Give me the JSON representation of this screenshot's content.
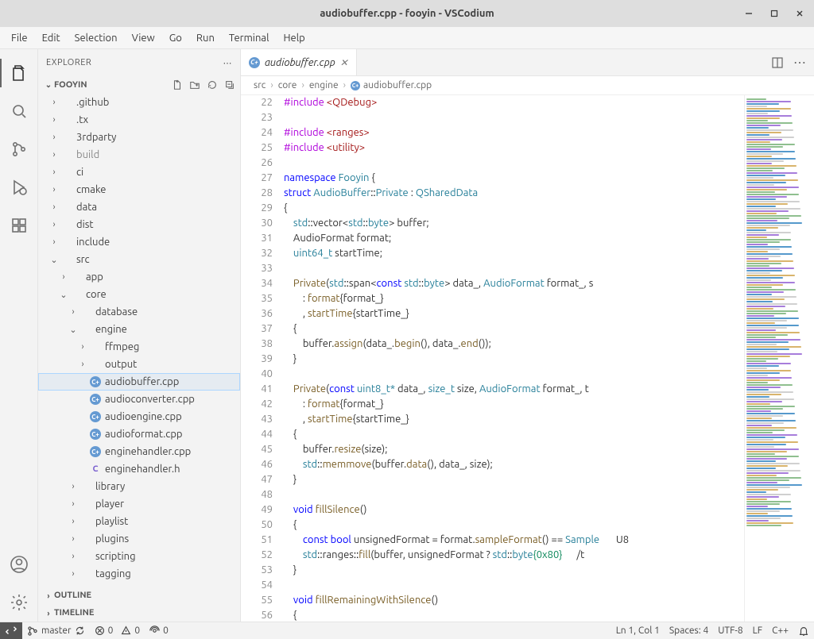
{
  "title": "audiobuffer.cpp - fooyin - VSCodium",
  "menus": [
    "File",
    "Edit",
    "Selection",
    "View",
    "Go",
    "Run",
    "Terminal",
    "Help"
  ],
  "explorer": {
    "title": "EXPLORER",
    "project": "FOOYIN",
    "outline": "OUTLINE",
    "timeline": "TIMELINE"
  },
  "tree": [
    {
      "d": 0,
      "t": "folder",
      "e": false,
      "l": ".github"
    },
    {
      "d": 0,
      "t": "folder",
      "e": false,
      "l": ".tx"
    },
    {
      "d": 0,
      "t": "folder",
      "e": false,
      "l": "3rdparty"
    },
    {
      "d": 0,
      "t": "folder",
      "e": false,
      "l": "build",
      "dim": true
    },
    {
      "d": 0,
      "t": "folder",
      "e": false,
      "l": "ci"
    },
    {
      "d": 0,
      "t": "folder",
      "e": false,
      "l": "cmake"
    },
    {
      "d": 0,
      "t": "folder",
      "e": false,
      "l": "data"
    },
    {
      "d": 0,
      "t": "folder",
      "e": false,
      "l": "dist"
    },
    {
      "d": 0,
      "t": "folder",
      "e": false,
      "l": "include"
    },
    {
      "d": 0,
      "t": "folder",
      "e": true,
      "l": "src"
    },
    {
      "d": 1,
      "t": "folder",
      "e": false,
      "l": "app"
    },
    {
      "d": 1,
      "t": "folder",
      "e": true,
      "l": "core"
    },
    {
      "d": 2,
      "t": "folder",
      "e": false,
      "l": "database"
    },
    {
      "d": 2,
      "t": "folder",
      "e": true,
      "l": "engine"
    },
    {
      "d": 3,
      "t": "folder",
      "e": false,
      "l": "ffmpeg"
    },
    {
      "d": 3,
      "t": "folder",
      "e": false,
      "l": "output"
    },
    {
      "d": 3,
      "t": "cpp",
      "l": "audiobuffer.cpp",
      "sel": true
    },
    {
      "d": 3,
      "t": "cpp",
      "l": "audioconverter.cpp"
    },
    {
      "d": 3,
      "t": "cpp",
      "l": "audioengine.cpp"
    },
    {
      "d": 3,
      "t": "cpp",
      "l": "audioformat.cpp"
    },
    {
      "d": 3,
      "t": "cpp",
      "l": "enginehandler.cpp"
    },
    {
      "d": 3,
      "t": "h",
      "l": "enginehandler.h"
    },
    {
      "d": 2,
      "t": "folder",
      "e": false,
      "l": "library"
    },
    {
      "d": 2,
      "t": "folder",
      "e": false,
      "l": "player"
    },
    {
      "d": 2,
      "t": "folder",
      "e": false,
      "l": "playlist"
    },
    {
      "d": 2,
      "t": "folder",
      "e": false,
      "l": "plugins"
    },
    {
      "d": 2,
      "t": "folder",
      "e": false,
      "l": "scripting"
    },
    {
      "d": 2,
      "t": "folder",
      "e": false,
      "l": "tagging"
    }
  ],
  "tab": {
    "label": "audiobuffer.cpp"
  },
  "crumbs": [
    "src",
    "core",
    "engine",
    "audiobuffer.cpp"
  ],
  "code_start": 22,
  "code": [
    [
      [
        "pp",
        "#include"
      ],
      [
        "",
        ""
      ],
      [
        "st",
        " <QDebug>"
      ]
    ],
    [],
    [
      [
        "pp",
        "#include"
      ],
      [
        "st",
        " <ranges>"
      ]
    ],
    [
      [
        "pp",
        "#include"
      ],
      [
        "st",
        " <utility>"
      ]
    ],
    [],
    [
      [
        "kw",
        "namespace"
      ],
      [
        "",
        " "
      ],
      [
        "ty",
        "Fooyin"
      ],
      [
        "",
        " {"
      ]
    ],
    [
      [
        "kw",
        "struct"
      ],
      [
        "",
        " "
      ],
      [
        "ty",
        "AudioBuffer"
      ],
      [
        "op",
        "::"
      ],
      [
        "ty",
        "Private"
      ],
      [
        "",
        " : "
      ],
      [
        "ty",
        "QSharedData"
      ]
    ],
    [
      [
        "",
        "{"
      ]
    ],
    [
      [
        "",
        "    "
      ],
      [
        "ty",
        "std"
      ],
      [
        "op",
        "::"
      ],
      [
        "",
        "vector<"
      ],
      [
        "ty",
        "std"
      ],
      [
        "op",
        "::"
      ],
      [
        "ty",
        "byte"
      ],
      [
        "",
        "> buffer;"
      ]
    ],
    [
      [
        "",
        "    AudioFormat format;"
      ]
    ],
    [
      [
        "",
        "    "
      ],
      [
        "ty",
        "uint64_t"
      ],
      [
        "",
        " startTime;"
      ]
    ],
    [],
    [
      [
        "",
        "    "
      ],
      [
        "fn",
        "Private"
      ],
      [
        "",
        "("
      ],
      [
        "ty",
        "std"
      ],
      [
        "op",
        "::"
      ],
      [
        "",
        "span<"
      ],
      [
        "kw",
        "const"
      ],
      [
        "",
        " "
      ],
      [
        "ty",
        "std"
      ],
      [
        "op",
        "::"
      ],
      [
        "ty",
        "byte"
      ],
      [
        "",
        "> data_, "
      ],
      [
        "ty",
        "AudioFormat"
      ],
      [
        "",
        " format_, s"
      ]
    ],
    [
      [
        "",
        "        : "
      ],
      [
        "fn",
        "format"
      ],
      [
        "",
        "{format_}"
      ]
    ],
    [
      [
        "",
        "        , "
      ],
      [
        "fn",
        "startTime"
      ],
      [
        "",
        "{startTime_}"
      ]
    ],
    [
      [
        "",
        "    {"
      ]
    ],
    [
      [
        "",
        "        buffer."
      ],
      [
        "fn",
        "assign"
      ],
      [
        "",
        "(data_."
      ],
      [
        "fn",
        "begin"
      ],
      [
        "",
        "(), data_."
      ],
      [
        "fn",
        "end"
      ],
      [
        "",
        "());"
      ]
    ],
    [
      [
        "",
        "    }"
      ]
    ],
    [],
    [
      [
        "",
        "    "
      ],
      [
        "fn",
        "Private"
      ],
      [
        "",
        "("
      ],
      [
        "kw",
        "const"
      ],
      [
        "",
        " "
      ],
      [
        "ty",
        "uint8_t*"
      ],
      [
        "",
        " data_, "
      ],
      [
        "ty",
        "size_t"
      ],
      [
        "",
        " size, "
      ],
      [
        "ty",
        "AudioFormat"
      ],
      [
        "",
        " format_, t"
      ]
    ],
    [
      [
        "",
        "        : "
      ],
      [
        "fn",
        "format"
      ],
      [
        "",
        "{format_}"
      ]
    ],
    [
      [
        "",
        "        , "
      ],
      [
        "fn",
        "startTime"
      ],
      [
        "",
        "{startTime_}"
      ]
    ],
    [
      [
        "",
        "    {"
      ]
    ],
    [
      [
        "",
        "        buffer."
      ],
      [
        "fn",
        "resize"
      ],
      [
        "",
        "(size);"
      ]
    ],
    [
      [
        "",
        "        "
      ],
      [
        "ty",
        "std"
      ],
      [
        "op",
        "::"
      ],
      [
        "fn",
        "memmove"
      ],
      [
        "",
        "(buffer."
      ],
      [
        "fn",
        "data"
      ],
      [
        "",
        "(), data_, size);"
      ]
    ],
    [
      [
        "",
        "    }"
      ]
    ],
    [],
    [
      [
        "",
        "    "
      ],
      [
        "kw",
        "void"
      ],
      [
        "",
        " "
      ],
      [
        "fn",
        "fillSilence"
      ],
      [
        "",
        "()"
      ]
    ],
    [
      [
        "",
        "    {"
      ]
    ],
    [
      [
        "",
        "        "
      ],
      [
        "kw",
        "const"
      ],
      [
        "",
        " "
      ],
      [
        "kw",
        "bool"
      ],
      [
        "",
        " unsignedFormat = format."
      ],
      [
        "fn",
        "sampleFormat"
      ],
      [
        "",
        "() == "
      ],
      [
        "ty",
        "Sample"
      ],
      [
        "",
        "       U8"
      ]
    ],
    [
      [
        "",
        "        "
      ],
      [
        "ty",
        "std"
      ],
      [
        "op",
        "::"
      ],
      [
        "",
        "ranges"
      ],
      [
        "op",
        "::"
      ],
      [
        "fn",
        "fill"
      ],
      [
        "",
        "(buffer, unsignedFormat ? "
      ],
      [
        "ty",
        "std"
      ],
      [
        "op",
        "::"
      ],
      [
        "ty",
        "byte"
      ],
      [
        "num",
        "{0x80}"
      ],
      [
        "",
        "      /t"
      ]
    ],
    [
      [
        "",
        "    }"
      ]
    ],
    [],
    [
      [
        "",
        "    "
      ],
      [
        "kw",
        "void"
      ],
      [
        "",
        " "
      ],
      [
        "fn",
        "fillRemainingWithSilence"
      ],
      [
        "",
        "()"
      ]
    ],
    [
      [
        "",
        "    {"
      ]
    ]
  ],
  "status": {
    "branch": "master",
    "errors": "0",
    "warnings": "0",
    "ports": "0",
    "cursor": "Ln 1, Col 1",
    "spaces": "Spaces: 4",
    "encoding": "UTF-8",
    "eol": "LF",
    "lang": "C++"
  }
}
